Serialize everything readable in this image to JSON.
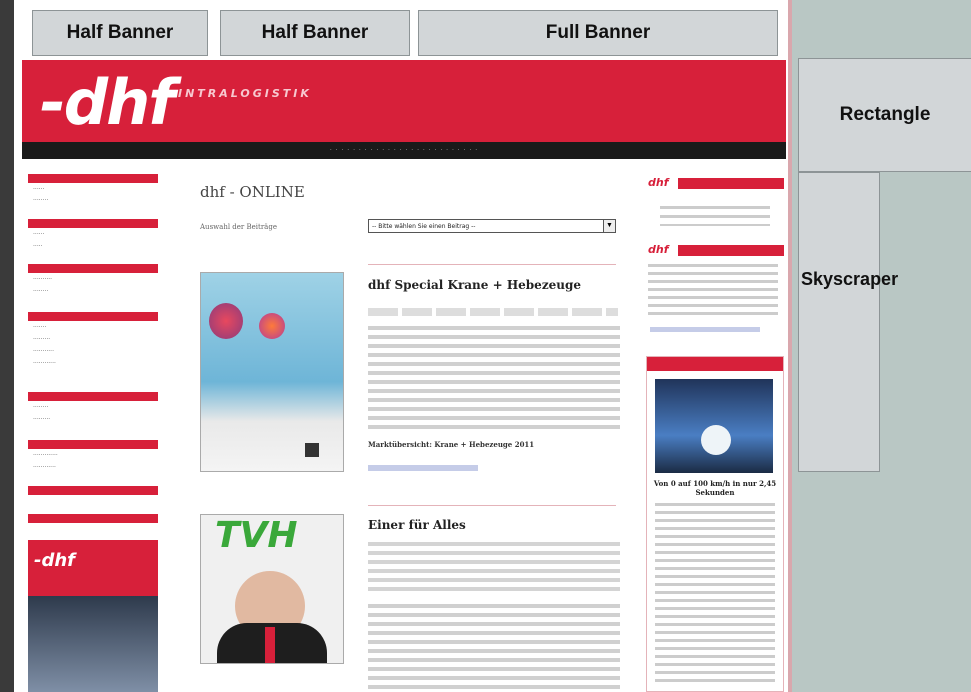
{
  "banners": {
    "half1": "Half Banner",
    "half2": "Half Banner",
    "full": "Full Banner",
    "rectangle": "Rectangle",
    "skyscraper": "Skyscraper"
  },
  "site": {
    "logo": "-dhf",
    "logo_sub": "INTRALOGISTIK"
  },
  "main": {
    "title": "dhf - ONLINE",
    "select_label": "Auswahl der Beiträge",
    "select_value": "-- Bitte wählen Sie einen Beitrag --",
    "articles": [
      {
        "title": "dhf Special Krane + Hebezeuge",
        "link": "Marktübersicht: Krane + Hebezeuge 2011"
      },
      {
        "title": "Einer für Alles",
        "image_text": "TVH"
      }
    ]
  },
  "right": {
    "car_caption": "Von 0 auf 100 km/h in nur 2,45 Sekunden"
  },
  "colors": {
    "brand_red": "#d7203a",
    "banner_gray": "#d2d6d8",
    "outer_teal": "#b9c7c4"
  }
}
